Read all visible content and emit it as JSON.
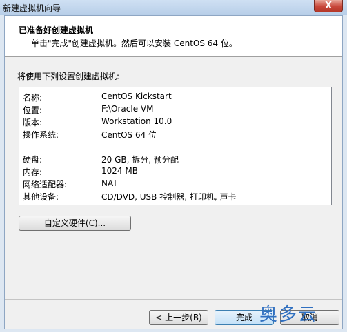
{
  "window": {
    "title": "新建虚拟机向导",
    "close_glyph": "X"
  },
  "header": {
    "title": "已准备好创建虚拟机",
    "subtitle": "单击\"完成\"创建虚拟机。然后可以安装 CentOS 64 位。"
  },
  "intro": "将使用下列设置创建虚拟机:",
  "settings": {
    "group1": [
      {
        "key": "名称:",
        "value": "CentOS Kickstart"
      },
      {
        "key": "位置:",
        "value": "F:\\Oracle VM"
      },
      {
        "key": "版本:",
        "value": "Workstation 10.0"
      },
      {
        "key": "操作系统:",
        "value": "CentOS 64 位"
      }
    ],
    "group2": [
      {
        "key": "硬盘:",
        "value": "20 GB, 拆分, 预分配"
      },
      {
        "key": "内存:",
        "value": "1024 MB"
      },
      {
        "key": "网络适配器:",
        "value": "NAT"
      },
      {
        "key": "其他设备:",
        "value": "CD/DVD, USB 控制器, 打印机, 声卡"
      }
    ]
  },
  "buttons": {
    "customize": "自定义硬件(C)...",
    "back": "< 上一步(B)",
    "finish": "完成",
    "cancel": "取消"
  },
  "watermark": "奥多云"
}
